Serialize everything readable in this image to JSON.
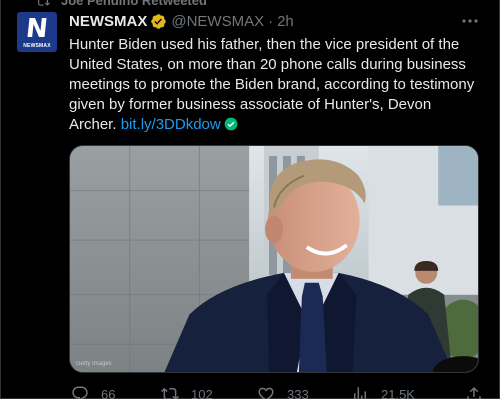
{
  "retweet_banner": {
    "text": "Joe Pendino Retweeted",
    "icon": "retweet-icon"
  },
  "author": {
    "avatar_logo_letter": "N",
    "avatar_logo_text": "NEWSMAX",
    "name": "NEWSMAX",
    "handle": "@NEWSMAX",
    "separator": "·",
    "time": "2h",
    "verified_icon": "gold-verified-badge-icon"
  },
  "tweet": {
    "body": "Hunter Biden used his father, then the vice president of the United States, on more than 20 phone calls during business meetings to promote the Biden brand, according to testimony given by former business associate of Hunter's, Devon Archer. ",
    "link": "bit.ly/3DDkdow"
  },
  "media": {
    "caption": "Getty Images"
  },
  "actions": {
    "replies": "66",
    "retweets": "102",
    "likes": "333",
    "views": "21.5K"
  },
  "colors": {
    "background": "#000000",
    "text": "#e7e9ea",
    "muted": "#71767b",
    "link": "#1d9bf0",
    "brand": "#1d3a8a",
    "verified_gold": "#e2b719"
  }
}
